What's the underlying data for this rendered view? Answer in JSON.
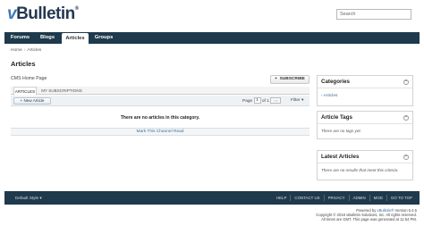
{
  "header": {
    "logo_prefix": "v",
    "logo_main": "Bulletin",
    "logo_mark": "®",
    "search_placeholder": "Search"
  },
  "nav": {
    "tabs": [
      {
        "label": "Forums"
      },
      {
        "label": "Blogs"
      },
      {
        "label": "Articles"
      },
      {
        "label": "Groups"
      }
    ]
  },
  "breadcrumb": {
    "home": "Home",
    "current": "Articles"
  },
  "page": {
    "title": "Articles",
    "cms_home": "CMS Home Page",
    "subscribe_label": "SUBSCRIBE",
    "subscribe_icon": "+"
  },
  "tabs": [
    {
      "label": "ARTICLES"
    },
    {
      "label": "MY SUBSCRIPTIONS"
    }
  ],
  "toolbar": {
    "new_article_label": "New Article",
    "new_article_icon": "+",
    "page_label": "Page",
    "page_value": "1",
    "page_of": "of 1",
    "filter_label": "Filter"
  },
  "content": {
    "empty_message": "There are no articles in this category.",
    "mark_read": "Mark This Channel Read"
  },
  "sidebar": {
    "categories": {
      "title": "Categories",
      "item": "Articles"
    },
    "tags": {
      "title": "Article Tags",
      "message": "There are no tags yet."
    },
    "latest": {
      "title": "Latest Articles",
      "message": "There are no results that meet this criteria."
    }
  },
  "footer": {
    "style_label": "Default Style",
    "links": [
      "HELP",
      "CONTACT US",
      "PRIVACY",
      "ADMIN",
      "MOD",
      "GO TO TOP"
    ]
  },
  "credits": {
    "line1_prefix": "Powered by ",
    "line1_link": "vBulletin®",
    "line1_suffix": " Version 5.4.5",
    "line2": "Copyright © 2018 vBulletin Solutions, Inc. All rights reserved.",
    "line3": "All times are GMT. This page was generated at 11:54 PM."
  },
  "colors": {
    "nav_bg": "#1e3a4c",
    "link": "#3e6f9a",
    "logo_dark": "#23384f",
    "logo_accent": "#3e79b7"
  }
}
